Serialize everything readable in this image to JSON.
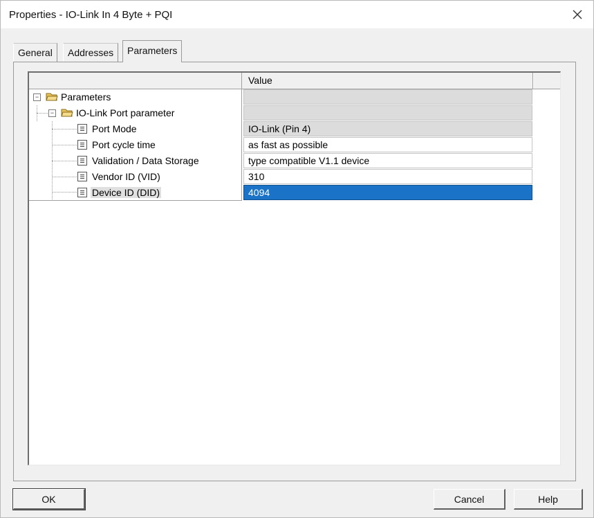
{
  "window": {
    "title": "Properties - IO-Link In  4 Byte + PQI",
    "close_icon": "close-icon"
  },
  "tabs": [
    {
      "label": "General",
      "active": false
    },
    {
      "label": "Addresses",
      "active": false
    },
    {
      "label": "Parameters",
      "active": true
    }
  ],
  "grid": {
    "value_header": "Value",
    "rows": [
      {
        "label": "Parameters",
        "value": "",
        "icon": "folder-open-icon",
        "level": 0,
        "style": "gray"
      },
      {
        "label": "IO-Link Port parameter",
        "value": "",
        "icon": "folder-open-icon",
        "level": 1,
        "style": "gray"
      },
      {
        "label": "Port Mode",
        "value": "IO-Link (Pin 4)",
        "icon": "parameter-icon",
        "level": 2,
        "style": "gray"
      },
      {
        "label": "Port cycle time",
        "value": "as fast as possible",
        "icon": "parameter-icon",
        "level": 2,
        "style": "white"
      },
      {
        "label": "Validation / Data Storage",
        "value": "type compatible V1.1 device",
        "icon": "parameter-icon",
        "level": 2,
        "style": "white"
      },
      {
        "label": "Vendor ID (VID)",
        "value": "310",
        "icon": "parameter-icon",
        "level": 2,
        "style": "white"
      },
      {
        "label": "Device ID (DID)",
        "value": "4094",
        "icon": "parameter-icon",
        "level": 2,
        "style": "selected"
      }
    ]
  },
  "buttons": {
    "ok": "OK",
    "cancel": "Cancel",
    "help": "Help"
  },
  "colors": {
    "selection": "#1a73c7",
    "dialog_background": "#f0f0f0"
  }
}
